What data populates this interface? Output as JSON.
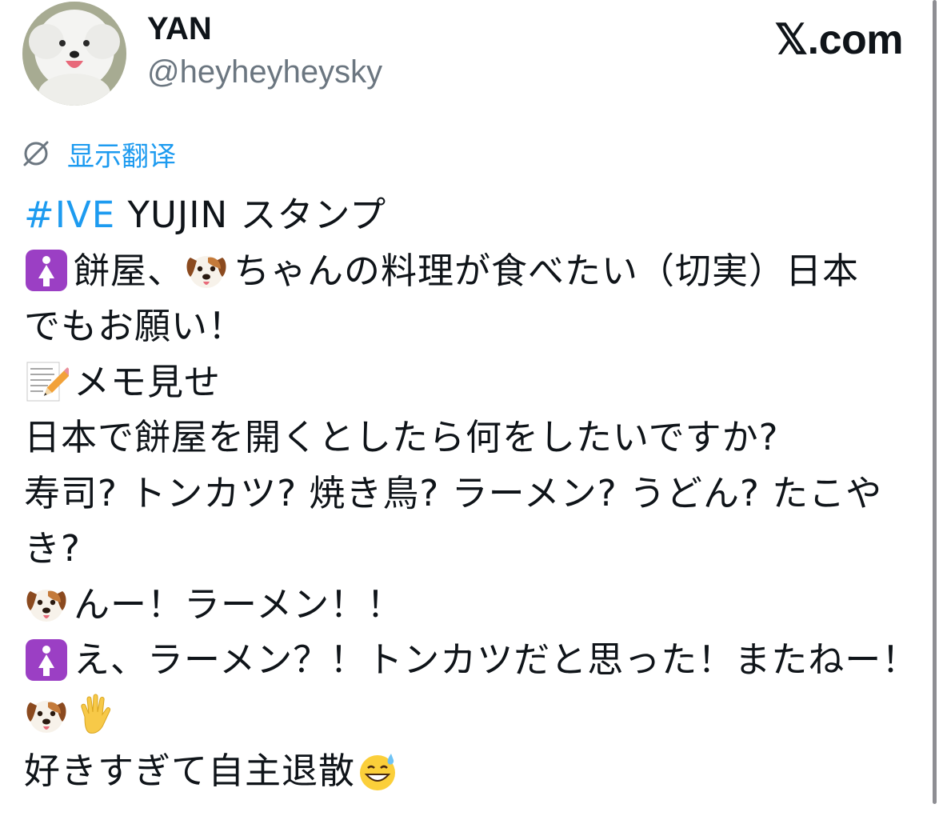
{
  "header": {
    "display_name": "YAN",
    "handle": "@heyheyheysky",
    "brand": "𝕏.com",
    "avatar_icon": "dog-avatar"
  },
  "translate": {
    "label": "显示翻译",
    "icon": "translate-icon"
  },
  "tweet": {
    "line1": {
      "hashtag": "#IVE",
      "text": " YUJIN スタンプ"
    },
    "line2": {
      "emoji1": "womens-room-icon",
      "text1": "餅屋、",
      "emoji2": "dog-face-icon",
      "text2": "ちゃんの料理が食べたい（切実）日本"
    },
    "line3": "でもお願い！",
    "line4": {
      "emoji": "memo-icon",
      "text": "メモ見せ"
    },
    "line5": "日本で餅屋を開くとしたら何をしたいですか?",
    "line6": "寿司? トンカツ? 焼き鳥? ラーメン? うどん? たこや",
    "line7": "き?",
    "line8": {
      "emoji": "dog-face-icon",
      "text": "んー！ラーメン！！"
    },
    "line9": {
      "emoji": "womens-room-icon",
      "text": "え、ラーメン？！トンカツだと思った！またねー！"
    },
    "line10": {
      "emoji1": "dog-face-icon",
      "emoji2": "raised-hand-icon"
    },
    "line11": {
      "text": "好きすぎて自主退散",
      "emoji": "grinning-sweat-icon"
    }
  },
  "colors": {
    "accent": "#1d9bf0",
    "text": "#0f1419",
    "secondary": "#6b7680",
    "womens_room_bg": "#9b3fc4"
  }
}
